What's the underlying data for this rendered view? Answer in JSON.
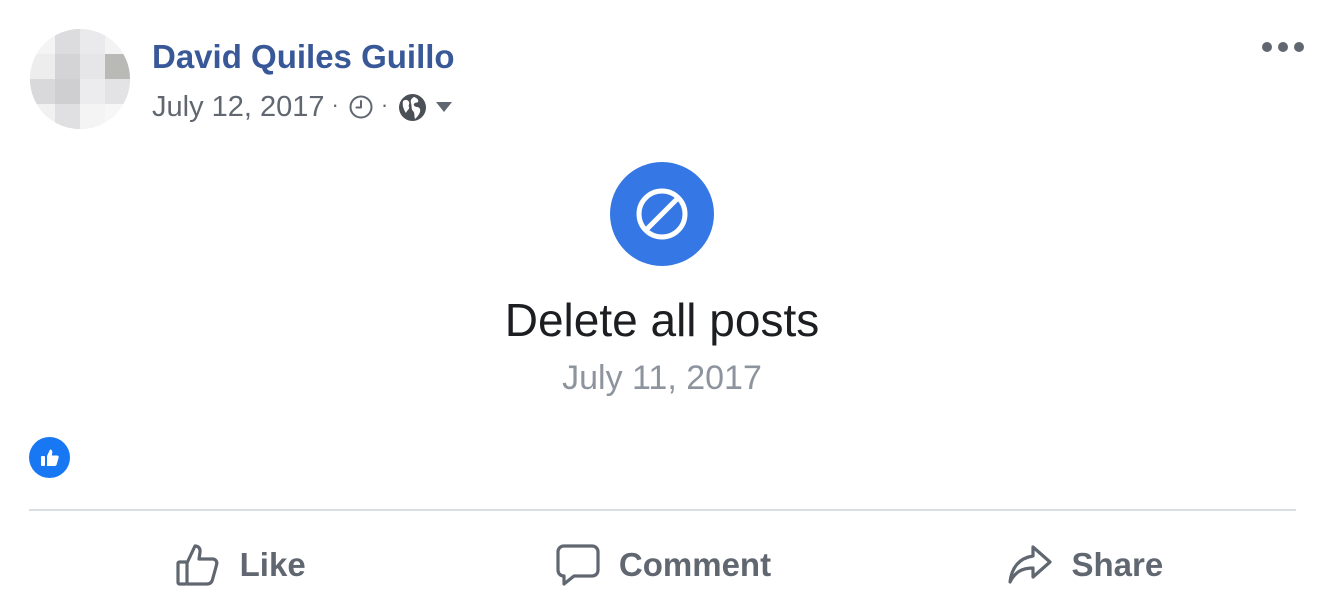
{
  "post": {
    "author": "David Quiles Guillo",
    "date": "July 12, 2017",
    "separator": "·",
    "icons": {
      "avatar": "blurred-profile-photo",
      "clock": "clock-icon",
      "audience": "globe-icon",
      "dropdown": "caret-down-icon",
      "more": "more-options-icon"
    },
    "event": {
      "icon": "blocked-icon",
      "title": "Delete all posts",
      "date": "July 11, 2017"
    },
    "reaction_icon": "like-reaction-icon",
    "actions": {
      "like": "Like",
      "comment": "Comment",
      "share": "Share"
    }
  },
  "colors": {
    "author_link": "#385898",
    "blocked_circle": "#3578e5",
    "like_badge": "#1877f2",
    "secondary_text": "#606770",
    "muted_text": "#8d949e",
    "divider": "#dadde1"
  }
}
